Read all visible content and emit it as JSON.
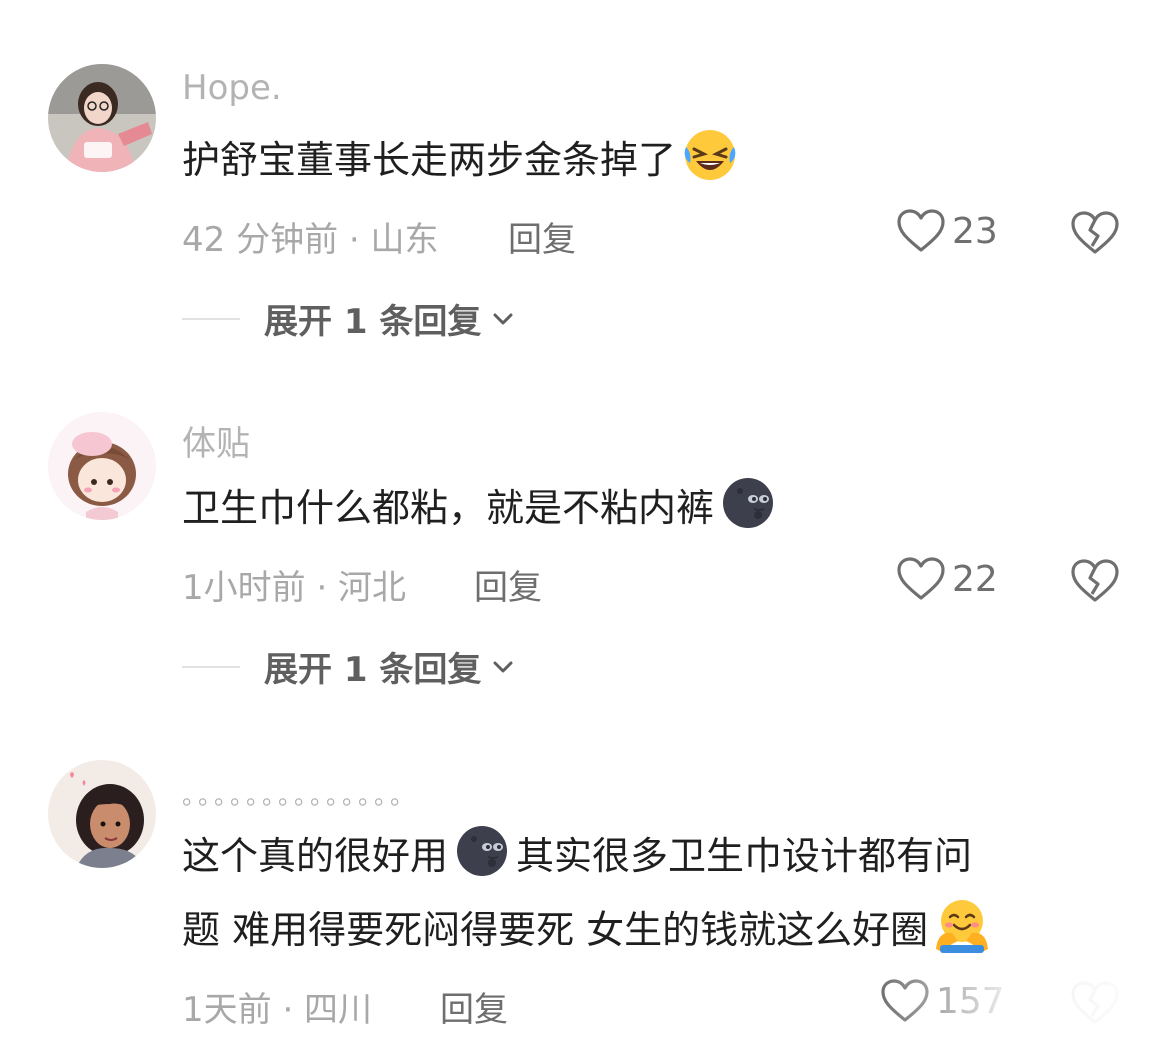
{
  "comments": [
    {
      "username": "Hope.",
      "text": "护舒宝董事长走两步金条掉了",
      "emoji": "grinning-squinting-face-with-tears-emoji",
      "time_location": "42 分钟前 · 山东",
      "reply_label": "回复",
      "likes": "23",
      "expand_label": "展开 1 条回复"
    },
    {
      "username": "体贴",
      "text": "卫生巾什么都粘，就是不粘内裤",
      "emoji": "new-moon-face-emoji",
      "time_location": "1小时前 · 河北",
      "reply_label": "回复",
      "likes": "22",
      "expand_label": "展开 1 条回复"
    },
    {
      "username": "。。。。。。。。。。。。。。",
      "text_line1_a": "这个真的很好用",
      "emoji_inline": "new-moon-face-emoji",
      "text_line1_b": "其实很多卫生巾设计都有问",
      "text_line2": "题 难用得要死闷得要死 女生的钱就这么好圈",
      "emoji_end": "hugging-face-emoji",
      "time_location": "1天前 · 四川",
      "reply_label": "回复",
      "likes": "157"
    }
  ],
  "icons": {
    "like": "heart-outline-icon",
    "dislike": "broken-heart-icon",
    "expand": "chevron-down-icon"
  },
  "colors": {
    "username": "#b3b3b3",
    "text": "#1f1f1f",
    "meta": "#a8a8a8",
    "action": "#6f6f6f"
  }
}
